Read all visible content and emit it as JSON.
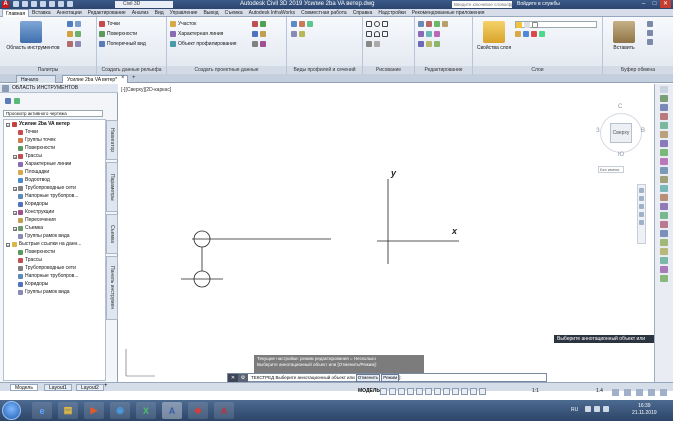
{
  "titlebar": {
    "logo": "A",
    "workspace": "Civil 3D",
    "title": "Autodesk Civil 3D 2019   Усилие 2ba VA ветер.dwg",
    "search_placeholder": "Введите ключевое слово/фразу",
    "user": "Войдите в службы"
  },
  "ribbon_tabs": [
    "Главная",
    "Вставка",
    "Аннотации",
    "Редактирование",
    "Анализ",
    "Вид",
    "Управление",
    "Вывод",
    "Съемка",
    "Autodesk InfraWorks",
    "Совместная работа",
    "Справка",
    "Надстройки",
    "Рекомендованные приложения"
  ],
  "ribbon": {
    "tool_area_label": "Область инструментов",
    "palettes_label": "Палитры",
    "points_label": "Точки",
    "surfaces_label": "Поверхности",
    "corridor_view_label": "Поперечный вид",
    "terrain_panel_label": "Создать данные рельефа",
    "parcel_label": "Участок",
    "feature_line_label": "Характерная линия",
    "profile_view_label": "Объект профилирования",
    "design_panel_label": "Создать проектные данные",
    "profile_panel_label": "Виды профилей и сечений",
    "draw_panel_label": "Рисование",
    "modify_panel_label": "Редактирование",
    "properties_label": "Свойства слоя",
    "layers_panel_label": "Слои",
    "paste_label": "Вставить",
    "clipboard_panel_label": "Буфер обмена"
  },
  "doc_tabs": {
    "start": "Начало",
    "active": "Усилие 2ba VA ветер*"
  },
  "toolspace": {
    "header": "ОБЛАСТЬ ИНСТРУМЕНТОВ",
    "view_select": "Просмотр активного чертежа",
    "tree": [
      "Усилие 2ba VA ветер",
      "Точки",
      "Группы точек",
      "Поверхности",
      "Трассы",
      "Характерные линии",
      "Площадки",
      "Водоотвод",
      "Трубопроводные сети",
      "Напорные трубопров...",
      "Коридоры",
      "Конструкции",
      "Пересечения",
      "Съемка",
      "Группы рамок вида",
      "Быстрые ссылки на данн...",
      "Поверхности",
      "Трассы",
      "Трубопроводные сети",
      "Напорные трубопров...",
      "Коридоры",
      "Группы рамок вида"
    ],
    "vtabs": [
      "Навигатор",
      "Параметры",
      "Съемка",
      "Панель инструмен"
    ]
  },
  "viewport": {
    "label": "[-][Сверху][2D-каркас]",
    "viewcube": {
      "top": "Сверху",
      "north": "С",
      "south": "Ю",
      "west": "З",
      "east": "В",
      "wcs": "Без имени"
    },
    "ucs_y": "y",
    "ucs_x": "x",
    "prompt": "Выберите аннотационный объект или"
  },
  "command": {
    "history": [
      "Текущие настройки: режим редактирования = Несколько",
      "Выберите аннотационный объект или [Отменить/Режим]:"
    ],
    "prefix": "ТЕКСТРЕД Выберите аннотационный объект или",
    "option1": "Отменить",
    "option2": "Режим",
    "suffix": "]:"
  },
  "layout_tabs": [
    "Модель",
    "Layout1",
    "Layout2"
  ],
  "status": {
    "model": "МОДЕЛЬ",
    "scale": "1:1",
    "scale2": "1.4"
  },
  "taskbar": {
    "lang": "RU",
    "time": "16:39",
    "date": "21.11.2019"
  },
  "colors": {
    "accent": "#2b4670",
    "ribbon": "#e1e7f0"
  }
}
